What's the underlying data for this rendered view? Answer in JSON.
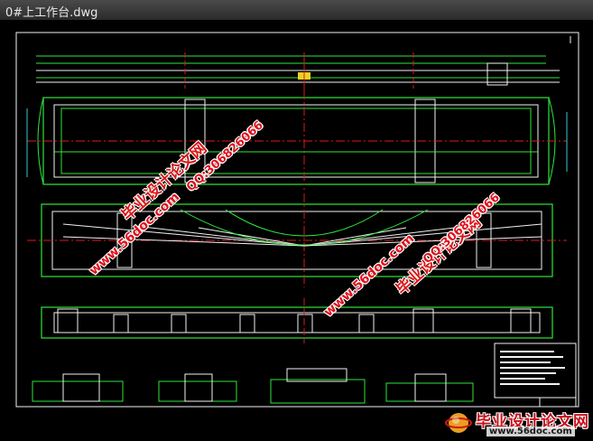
{
  "window": {
    "title": "0#上工作台.dwg"
  },
  "watermarks": {
    "site_cn": "毕业设计论文网",
    "site_url": "www.56doc.com",
    "qq": "QQ:306826066"
  },
  "brand": {
    "name": "毕业设计论文网",
    "url": "www.56doc.com",
    "logo_icon": "globe-logo-icon"
  },
  "colors": {
    "background": "#000000",
    "outline_green": "#2ee63a",
    "line_white": "#f2f2f2",
    "center_red": "#e01818",
    "dim_cyan": "#38c8d8",
    "accent_yellow": "#f0d020",
    "watermark_red": "#e0101a"
  }
}
